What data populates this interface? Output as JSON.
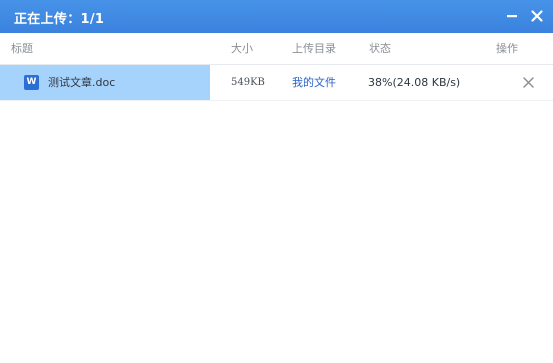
{
  "window": {
    "title": "正在上传：1/1"
  },
  "columns": {
    "title": "标题",
    "size": "大小",
    "directory": "上传目录",
    "status": "状态",
    "action": "操作"
  },
  "uploads": [
    {
      "icon_label": "W",
      "icon_name": "word-doc-icon",
      "name": "测试文章.doc",
      "size": "549KB",
      "directory": "我的文件",
      "status": "38%(24.08 KB/s)",
      "progress": 0.38
    }
  ],
  "colors": {
    "titlebar": "#3d87e2",
    "progress": "#a6d3fb",
    "link": "#2a62c9",
    "word_icon": "#2b6fd6"
  }
}
